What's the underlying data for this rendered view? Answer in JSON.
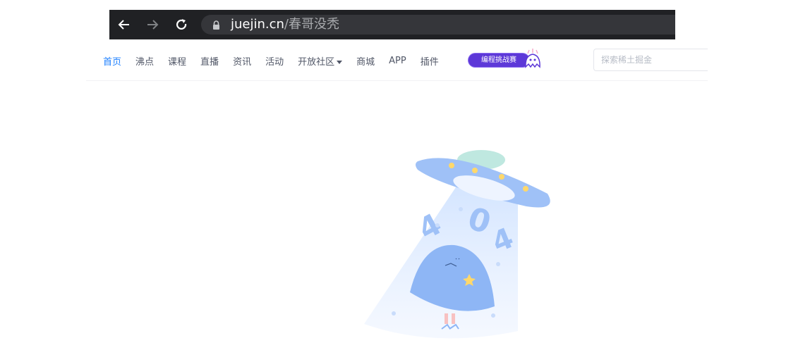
{
  "browser": {
    "url_host": "juejin.cn",
    "url_path": "/春哥没秃",
    "back_icon": "back-arrow-icon",
    "forward_icon": "forward-arrow-icon",
    "reload_icon": "reload-icon",
    "lock_icon": "lock-icon"
  },
  "nav": {
    "items": [
      {
        "label": "首页",
        "active": true
      },
      {
        "label": "沸点"
      },
      {
        "label": "课程"
      },
      {
        "label": "直播"
      },
      {
        "label": "资讯"
      },
      {
        "label": "活动"
      },
      {
        "label": "开放社区"
      },
      {
        "label": "商城"
      },
      {
        "label": "APP"
      },
      {
        "label": "插件"
      }
    ],
    "badge_label": "编程挑战赛",
    "search_placeholder": "探索稀土掘金"
  },
  "error": {
    "code_digits": [
      "4",
      "0",
      "4"
    ]
  },
  "colors": {
    "active_link": "#1e80ff",
    "text": "#515767",
    "browser_bar": "#202124",
    "badge": "#5d38d8",
    "ufo": "#8eb6f5"
  }
}
